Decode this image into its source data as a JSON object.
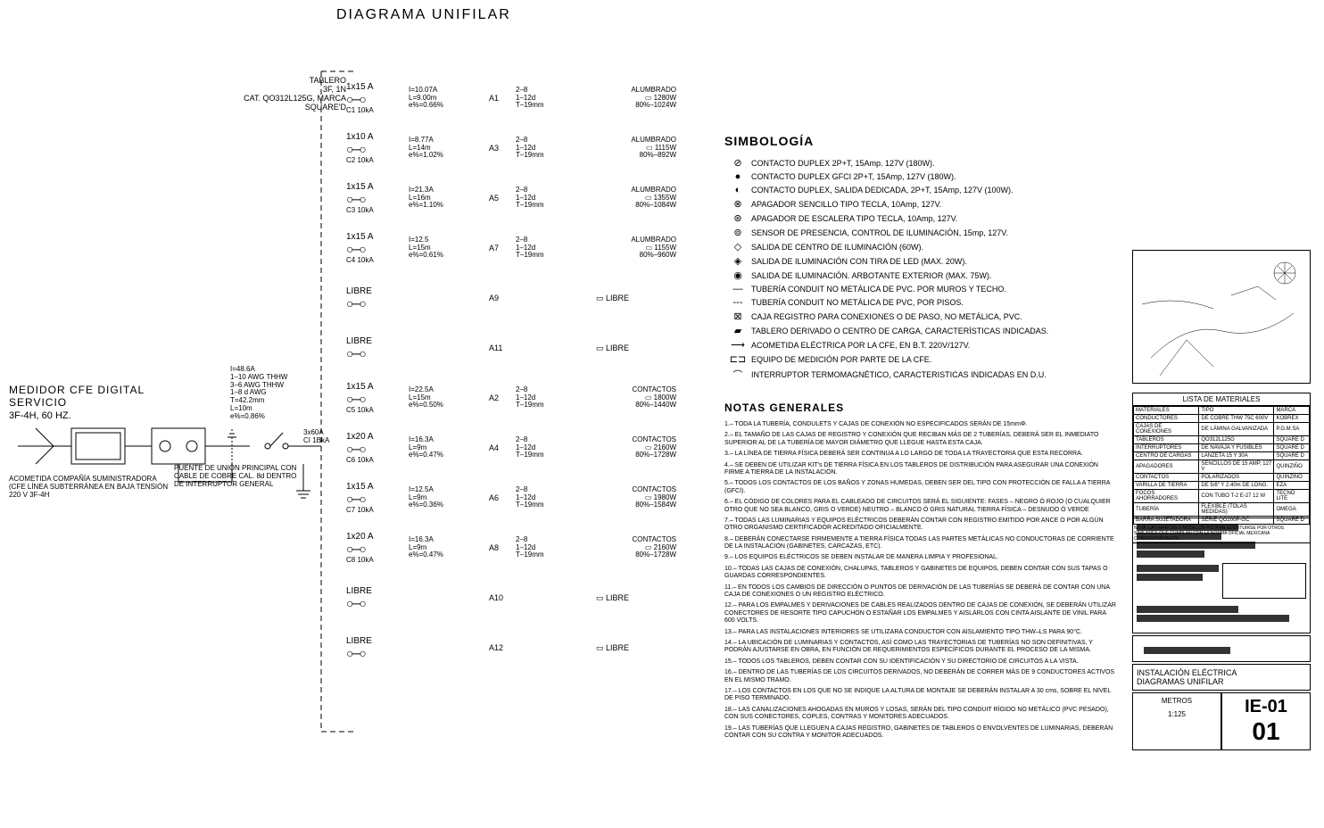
{
  "title": "DIAGRAMA UNIFILAR",
  "service": {
    "medidor": "MEDIDOR CFE DIGITAL",
    "servicio": "SERVICIO",
    "freq": "3F-4H, 60 HZ.",
    "acometida": "ACOMETIDA COMPAÑÍA SUMINISTRADORA (CFE LÍNEA SUBTERRÁNEA EN BAJA TENSIÓN 220 V 3F-4H"
  },
  "puente": "PUENTE DE UNIÓN PRINCIPAL CON CABLE DE COBRE CAL. 8d DENTRO DE INTERRUPTOR GENERAL",
  "tablero": {
    "l1": "TABLERO",
    "l2": "3F, 1N",
    "l3": "CAT. QO312L125G, MARCA SQUARE'D"
  },
  "feeder": {
    "i": "I=48.6A",
    "ph": "1–10 AWG THHW",
    "n": "3–6   AWG THHW",
    "g": "1–8  d  AWG",
    "t": "T=42.2mm",
    "l": "L=10m",
    "e": "e%=0.86%"
  },
  "ig": {
    "amp": "3x60A",
    "ci": "CI 1BkA"
  },
  "circuits": [
    {
      "cb": "1x15 A",
      "ci": "C1 10kA",
      "i": "I=10.07A",
      "l": "L=9.00m",
      "e": "e%=0.66%",
      "n": "A1",
      "w1": "2–8",
      "w2": "1–12d",
      "w3": "T–19mm",
      "type": "ALUMBRADO",
      "p1": "1280W",
      "p2": "80%–1024W"
    },
    {
      "cb": "1x10 A",
      "ci": "C2 10kA",
      "i": "I=8.77A",
      "l": "L=14m",
      "e": "e%=1.02%",
      "n": "A3",
      "w1": "2–8",
      "w2": "1–12d",
      "w3": "T–19mm",
      "type": "ALUMBRADO",
      "p1": "1115W",
      "p2": "80%–892W"
    },
    {
      "cb": "1x15 A",
      "ci": "C3 10kA",
      "i": "I=21.3A",
      "l": "L=16m",
      "e": "e%=1.10%",
      "n": "A5",
      "w1": "2–8",
      "w2": "1–12d",
      "w3": "T–19mm",
      "type": "ALUMBRADO",
      "p1": "1355W",
      "p2": "80%–1084W"
    },
    {
      "cb": "1x15 A",
      "ci": "C4 10kA",
      "i": "I=12.5",
      "l": "L=15m",
      "e": "e%=0.61%",
      "n": "A7",
      "w1": "2–8",
      "w2": "1–12d",
      "w3": "T–19mm",
      "type": "ALUMBRADO",
      "p1": "1155W",
      "p2": "80%–960W"
    },
    {
      "cb": "LIBRE",
      "n": "A9",
      "libre": "LIBRE"
    },
    {
      "cb": "LIBRE",
      "n": "A11",
      "libre": "LIBRE"
    },
    {
      "cb": "1x15 A",
      "ci": "C5 10kA",
      "i": "I=22.5A",
      "l": "L=15m",
      "e": "e%=0.50%",
      "n": "A2",
      "w1": "2–8",
      "w2": "1–12d",
      "w3": "T–19mm",
      "type": "CONTACTOS",
      "p1": "1800W",
      "p2": "80%–1440W"
    },
    {
      "cb": "1x20 A",
      "ci": "C6 10kA",
      "i": "I=16.3A",
      "l": "L=9m",
      "e": "e%=0.47%",
      "n": "A4",
      "w1": "2–8",
      "w2": "1–12d",
      "w3": "T–19mm",
      "type": "CONTACTOS",
      "p1": "2160W",
      "p2": "80%–1728W"
    },
    {
      "cb": "1x15 A",
      "ci": "C7 10kA",
      "i": "I=12.5A",
      "l": "L=9m",
      "e": "e%=0.36%",
      "n": "A6",
      "w1": "2–8",
      "w2": "1–12d",
      "w3": "T–19mm",
      "type": "CONTACTOS",
      "p1": "1980W",
      "p2": "80%–1584W"
    },
    {
      "cb": "1x20 A",
      "ci": "C8 10kA",
      "i": "I=16.3A",
      "l": "L=9m",
      "e": "e%=0.47%",
      "n": "A8",
      "w1": "2–8",
      "w2": "1–12d",
      "w3": "T–19mm",
      "type": "CONTACTOS",
      "p1": "2160W",
      "p2": "80%–1728W"
    },
    {
      "cb": "LIBRE",
      "n": "A10",
      "libre": "LIBRE"
    },
    {
      "cb": "LIBRE",
      "n": "A12",
      "libre": "LIBRE"
    }
  ],
  "simbologia_title": "SIMBOLOGÍA",
  "simbologia": [
    {
      "g": "⊘",
      "t": "CONTACTO DUPLEX 2P+T, 15Amp. 127V (180W)."
    },
    {
      "g": "●",
      "t": "CONTACTO DUPLEX GFCI 2P+T, 15Amp, 127V (180W)."
    },
    {
      "g": "◐",
      "t": "CONTACTO DUPLEX, SALIDA DEDICADA, 2P+T, 15Amp, 127V (100W)."
    },
    {
      "g": "⊗",
      "t": "APAGADOR SENCILLO TIPO TECLA, 10Amp, 127V."
    },
    {
      "g": "⊛",
      "t": "APAGADOR DE ESCALERA TIPO TECLA, 10Amp, 127V."
    },
    {
      "g": "⊚",
      "t": "SENSOR DE PRESENCIA, CONTROL DE ILUMINACIÓN, 15mp, 127V."
    },
    {
      "g": "◇",
      "t": "SALIDA DE CENTRO DE ILUMINACIÓN (60W)."
    },
    {
      "g": "◈",
      "t": "SALIDA DE ILUMINACIÓN CON TIRA DE LED (MAX. 20W)."
    },
    {
      "g": "◉",
      "t": "SALIDA DE ILUMINACIÓN. ARBOTANTE EXTERIOR (MAX. 75W)."
    },
    {
      "g": "—",
      "t": "TUBERÍA CONDUIT NO METÁLICA DE PVC. POR MUROS Y TECHO."
    },
    {
      "g": "---",
      "t": "TUBERÍA CONDUIT NO METÁLICA DE PVC, POR PISOS."
    },
    {
      "g": "⊠",
      "t": "CAJA REGISTRO PARA CONEXIONES O DE PASO, NO METÁLICA, PVC."
    },
    {
      "g": "▰",
      "t": "TABLERO DERIVADO O CENTRO DE CARGA, CARACTERÍSTICAS INDICADAS."
    },
    {
      "g": "⟶",
      "t": "ACOMETIDA ELÉCTRICA POR LA CFE, EN B.T. 220V/127V."
    },
    {
      "g": "⊏⊐",
      "t": "EQUIPO DE MEDICIÓN POR PARTE DE LA CFE."
    },
    {
      "g": "⌒",
      "t": "INTERRUPTOR TERMOMAGNÉTICO, CARACTERISTICAS INDICADAS EN D.U."
    }
  ],
  "notas_title": "NOTAS GENERALES",
  "notas": [
    "1.– TODA LA TUBERÍA, CONDULETS Y CAJAS DE CONEXIÓN NO ESPECIFICADOS SERÁN DE 15mmΦ.",
    "2.– EL TAMAÑO DE LAS CAJAS DE REGISTRO Y CONEXIÓN QUE RECIBAN MÁS DE 2 TUBERÍAS, DEBERÁ SER EL INMEDIATO SUPERIOR AL DE LA TUBERÍA DE MAYOR DIÁMETRO QUE LLEGUE HASTA ESTA CAJA.",
    "3.– LA LÍNEA DE TIERRA FÍSICA DEBERÁ SER CONTINUA A LO LARGO DE TODA LA TRAYECTORIA QUE ESTA RECORRA.",
    "4.– SE DEBEN DE UTILIZAR KIT's DE TIERRA FÍSICA EN LOS TABLEROS DE DISTRIBUCIÓN PARA ASEGURAR UNA CONEXIÓN FIRME A TIERRA DE LA INSTALACIÓN.",
    "5.– TODOS LOS CONTACTOS DE LOS BAÑOS Y ZONAS HUMEDAS, DEBEN SER DEL TIPO CON PROTECCIÓN DE FALLA A TIERRA (GFCI).",
    "6.– EL CÓDIGO DE COLORES PARA EL CABLEADO DE CIRCUITOS SERÁ EL SIGUIENTE:  FASES – NEGRO Ó ROJO (O CUALQUIER OTRO QUE NO SEA BLANCO, GRIS O VERDE)  NEUTRO – BLANCO Ó GRIS NATURAL  TIERRA FÍSICA – DESNUDO Ó VERDE",
    "7.– TODAS LAS LUMINARIAS Y EQUIPOS ELÉCTRICOS DEBERÁN CONTAR CON REGISTRO EMITIDO POR ANCE O POR ALGÚN OTRO ORGANISMO CERTIFICADOR ACREDITADO OFICIALMENTE.",
    "8.– DEBERÁN CONECTARSE FIRMEMENTE A TIERRA FÍSICA TODAS LAS PARTES METÁLICAS NO CONDUCTORAS DE CORRIENTE DE LA INSTALACIÓN (GABINETES, CARCAZAS, ETC).",
    "9.– LOS EQUIPOS ELÉCTRICOS SE DEBEN INSTALAR DE MANERA LIMPIA Y PROFESIONAL.",
    "10.– TODAS LAS CAJAS DE CONEXIÓN, CHALUPAS, TABLEROS Y GABINETES DE EQUIPOS, DEBEN CONTAR CON SUS TAPAS O GUARDAS CORRESPONDIENTES.",
    "11.– EN TODOS LOS CAMBIOS DE DIRECCIÓN O PUNTOS DE DERIVACIÓN DE LAS TUBERÍAS SE DEBERÁ DE CONTAR CON UNA CAJA DE CONEXIONES O UN REGISTRO ELÉCTRICO.",
    "12.– PARA LOS EMPALMES Y DERIVACIONES DE CABLES REALIZADOS DENTRO DE CAJAS DE CONEXIÓN, SE DEBERÁN UTILIZAR CONECTORES DE RESORTE TIPO CAPUCHÓN O ESTAÑAR LOS EMPALMES Y AISLARLOS CON CINTA AISLANTE DE VINIL PARA 600 VOLTS.",
    "13.– PARA LAS INSTALACIONES INTERIORES SE UTILIZARA CONDUCTOR CON AISLAMIENTO TIPO THW–LS PARA 90°C.",
    "14.– LA UBICACIÓN DE LUMINARIAS Y CONTACTOS, ASÍ COMO LAS TRAYECTORIAS DE TUBERÍAS NO SON DEFINITIVAS, Y PODRÁN AJUSTARSE EN OBRA, EN FUNCIÓN DE REQUERIMIENTOS ESPECÍFICOS DURANTE EL PROCESO DE LA MISMA.",
    "15.– TODOS LOS TABLEROS, DEBEN CONTAR CON SU IDENTIFICACIÓN Y SU DIRECTORIO DE CIRCUITOS A LA VISTA.",
    "16.– DENTRO DE LAS TUBERÍAS DE LOS CIRCUITOS DERIVADOS, NO DEBERÁN DE CORRER MÁS DE 9 CONDUCTORES ACTIVOS EN EL MISMO TRAMO.",
    "17.– LOS CONTACTOS EN LOS QUE NO SE INDIQUE LA ALTURA DE MONTAJE SE DEBERÁN INSTALAR A 30 cms, SOBRE EL NIVEL DE PISO TERMINADO.",
    "18.– LAS CANALIZACIONES AHOGADAS EN MUROS Y LOSAS, SERÁN DEL TIPO CONDUIT RÍGIDO NO METÁLICO (PVC PESADO), CON SUS CONECTORES, COPLES, CONTRAS Y MONITORES ADECUADOS.",
    "19.– LAS TUBERÍAS QUE LLEGUEN A CAJAS REGISTRO, GABINETES DE TABLEROS O ENVOLVENTES DE LUMINARIAS, DEBERÁN CONTAR CON SU CONTRA Y MONITOR ADECUADOS."
  ],
  "materiales": {
    "title": "LISTA DE MATERIALES",
    "rows": [
      [
        "MATERIALES",
        "TIPO",
        "MARCA"
      ],
      [
        "CONDUCTORES",
        "DE COBRE THW 75C 600V",
        "KOBREX"
      ],
      [
        "CAJAS DE CONEXIONES",
        "DE LÁMINA GALVANIZADA",
        "P.G.M.SA"
      ],
      [
        "TABLEROS",
        "QO312L125G",
        "SQUARE D"
      ],
      [
        "INTERRUPTORES",
        "DE NAVAJA Y FUSIBLES",
        "SQUARE D"
      ],
      [
        "CENTRO DE CARGAS",
        "LANZETA 15 Y 30A",
        "SQUARE D"
      ],
      [
        "APAGADORES",
        "SENCILLOS DE 15 AMP, 127 V",
        "QUINZIÑO"
      ],
      [
        "CONTACTOS",
        "POLARIZADOS",
        "QUINZIÑO"
      ],
      [
        "VARILLA DE TIERRA",
        "DE 5/8\" Y 2.40m DE LONG.",
        "EZA"
      ],
      [
        "FOCOS AHORRADORES",
        "CON TUBO T-2 E-27 12 W",
        "TECNO LITE"
      ],
      [
        "TUBERÍA",
        "FLEXIBLE (TOLAS MEDIDAS)",
        "OMEGA"
      ],
      [
        "BARRA SUJETADORA",
        "SERIE QO200P-GC",
        "SQUARE D"
      ]
    ],
    "note": "NOTA: LAS MARCAS Y MODELOS PODRÁN SUSTITUIRSE POR OTROS SIMILARES QUE CUMPLAN CON LA NORMA OFICIAL MEXICANA CORRESPONDIENTE."
  },
  "titleblock": {
    "inst1": "INSTALACIÓN ELÉCTRICA",
    "inst2": "DIAGRAMAS UNIFILAR",
    "metros": "METROS",
    "scale": "1:125",
    "sheet": "IE-01",
    "num": "01"
  }
}
